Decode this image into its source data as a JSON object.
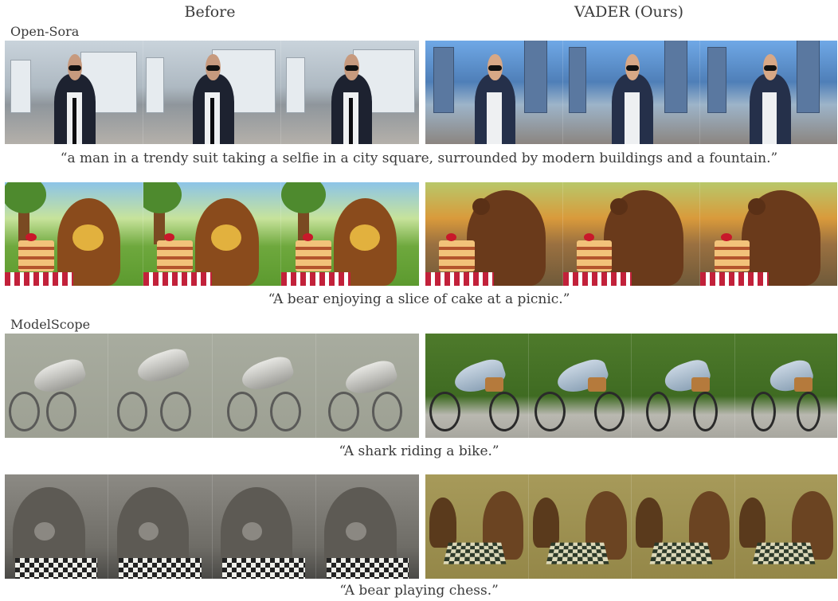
{
  "columns": {
    "left": "Before",
    "right": "VADER (Ours)"
  },
  "groups": [
    {
      "label": "Open-Sora"
    },
    {
      "label": "ModelScope"
    }
  ],
  "captions": [
    "“a man in a trendy suit taking a selfie in a city square, surrounded by modern buildings and a fountain.”",
    "“A bear enjoying a slice of cake at a picnic.”",
    "“A shark riding a bike.”",
    "“A bear playing chess.”"
  ]
}
